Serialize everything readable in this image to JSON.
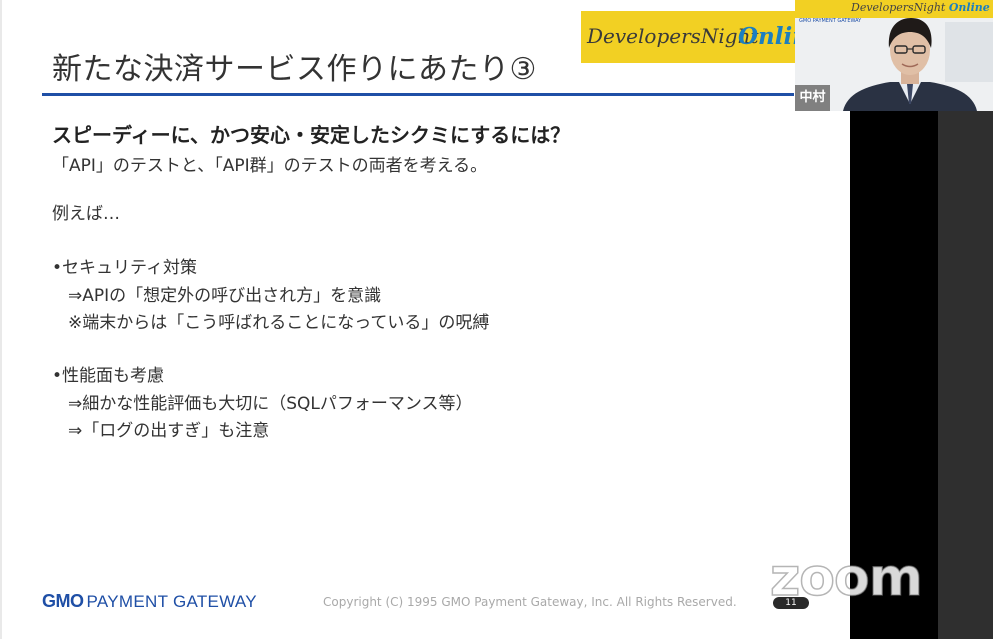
{
  "slide": {
    "title": "新たな決済サービス作りにあたり③",
    "heading": "スピーディーに、かつ安心・安定したシクミにするには？",
    "intro": "「API」のテストと、「API群」のテストの両者を考える。",
    "example": "例えば…",
    "security": {
      "bullet": "•セキュリティ対策",
      "line1": "⇒APIの「想定外の呼び出され方」を意識",
      "line2": "※端末からは「こう呼ばれることになっている」の呪縛"
    },
    "performance": {
      "bullet": "•性能面も考慮",
      "line1": "⇒細かな性能評価も大切に（SQLパフォーマンス等）",
      "line2": "⇒「ログの出すぎ」も注意"
    }
  },
  "banner": {
    "left_text": "DevelopersNight",
    "right_text": "Online"
  },
  "footer": {
    "logo_gmo": "GMO",
    "logo_sub": "PAYMENT GATEWAY",
    "copyright": "Copyright (C) 1995 GMO Payment Gateway, Inc. All Rights Reserved.",
    "page_number": "11"
  },
  "zoom": {
    "watermark": "zoom"
  },
  "webcam": {
    "name_tag": "中村",
    "banner_left": "DevelopersNight",
    "banner_right": "Online",
    "gmo_text": "GMO PAYMENT GATEWAY"
  },
  "colors": {
    "accent_blue": "#1f4fa6",
    "banner_yellow": "#f2d023",
    "online_blue": "#1c7fbf"
  }
}
